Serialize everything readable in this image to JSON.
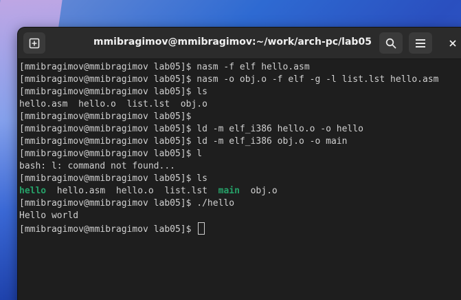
{
  "window": {
    "title": "mmibragimov@mmibragimov:~/work/arch-pc/lab05"
  },
  "toolbar": {
    "new_tab_icon": "new-tab-icon",
    "search_icon": "search-icon",
    "menu_icon": "hamburger-menu-icon",
    "close_icon": "close-icon"
  },
  "terminal": {
    "prompt": "[mmibragimov@mmibragimov lab05]$ ",
    "lines": [
      "[mmibragimov@mmibragimov lab05]$ nasm -f elf hello.asm",
      "[mmibragimov@mmibragimov lab05]$ nasm -o obj.o -f elf -g -l list.lst hello.asm",
      "[mmibragimov@mmibragimov lab05]$ ls",
      "hello.asm  hello.o  list.lst  obj.o",
      "[mmibragimov@mmibragimov lab05]$",
      "[mmibragimov@mmibragimov lab05]$ ld -m elf_i386 hello.o -o hello",
      "[mmibragimov@mmibragimov lab05]$ ld -m elf_i386 obj.o -o main",
      "[mmibragimov@mmibragimov lab05]$ l",
      "bash: l: command not found...",
      "[mmibragimov@mmibragimov lab05]$ ls"
    ],
    "ls_output": {
      "hello": "hello",
      "gap1": "  ",
      "hello_asm": "hello.asm",
      "gap2": "  ",
      "hello_o": "hello.o",
      "gap3": "  ",
      "list_lst": "list.lst",
      "gap4": "  ",
      "main": "main",
      "gap5": "  ",
      "obj_o": "obj.o"
    },
    "after_lines": [
      "[mmibragimov@mmibragimov lab05]$ ./hello",
      "Hello world"
    ]
  },
  "colors": {
    "executable": "#26a269",
    "text": "#d0d0d0",
    "background": "#1e1e1e"
  }
}
